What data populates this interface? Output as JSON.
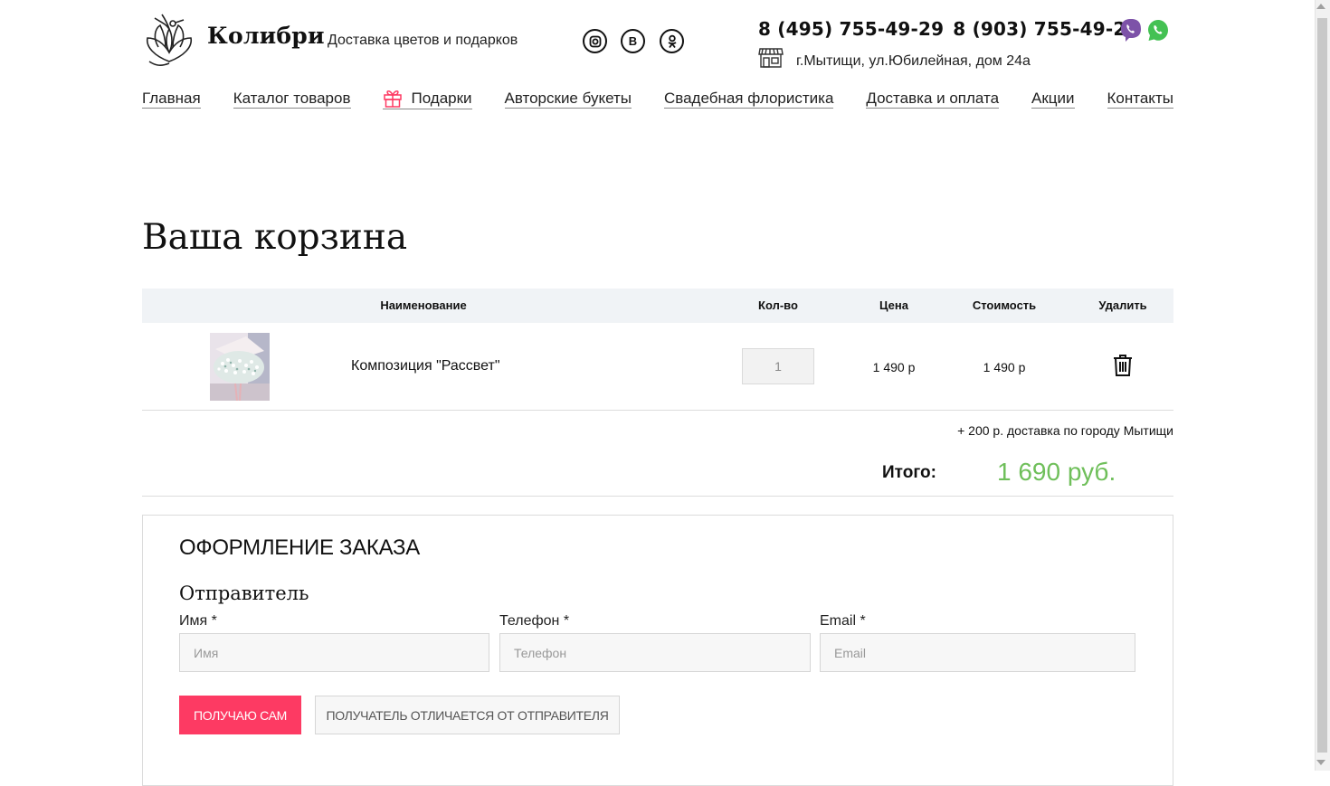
{
  "header": {
    "brand": "Колибри",
    "tagline": "Доставка цветов и подарков",
    "social": [
      {
        "icon": "instagram-icon",
        "label": ""
      },
      {
        "icon": "vk-icon",
        "label": "B"
      },
      {
        "icon": "odnoklassniki-icon",
        "label": ""
      }
    ],
    "phones": [
      "8 (495) 755-49-29",
      "8 (903) 755-49-29"
    ],
    "messengers": [
      "viber-icon",
      "whatsapp-icon"
    ],
    "address": "г.Мытищи, ул.Юбилейная, дом 24а"
  },
  "nav": {
    "items": [
      {
        "label": "Главная"
      },
      {
        "label": "Каталог товаров"
      },
      {
        "label": "Подарки",
        "icon": "gift-icon"
      },
      {
        "label": "Авторские букеты"
      },
      {
        "label": "Свадебная флористика"
      },
      {
        "label": "Доставка и оплата"
      },
      {
        "label": "Акции"
      },
      {
        "label": "Контакты"
      }
    ]
  },
  "page_title": "Ваша корзина",
  "cart": {
    "columns": {
      "name": "Наименование",
      "qty": "Кол-во",
      "price": "Цена",
      "cost": "Стоимость",
      "delete": "Удалить"
    },
    "rows": [
      {
        "name": "Композиция \"Рассвет\"",
        "qty": "1",
        "price": "1 490 р",
        "cost": "1 490 р"
      }
    ],
    "delivery_note": "+ 200 р. доставка по городу Мытищи",
    "total_label": "Итого:",
    "total_value": "1 690 руб."
  },
  "order": {
    "title": "Оформление заказа",
    "sender_title": "Отправитель",
    "fields": [
      {
        "label": "Имя *",
        "placeholder": "Имя"
      },
      {
        "label": "Телефон *",
        "placeholder": "Телефон"
      },
      {
        "label": "Email *",
        "placeholder": "Email"
      }
    ],
    "btn_self": "Получаю сам",
    "btn_other": "Получатель отличается от отправителя"
  },
  "colors": {
    "accent": "#fd3a63",
    "total": "#6fbf5a",
    "table_header_bg": "#f0f3f6"
  }
}
